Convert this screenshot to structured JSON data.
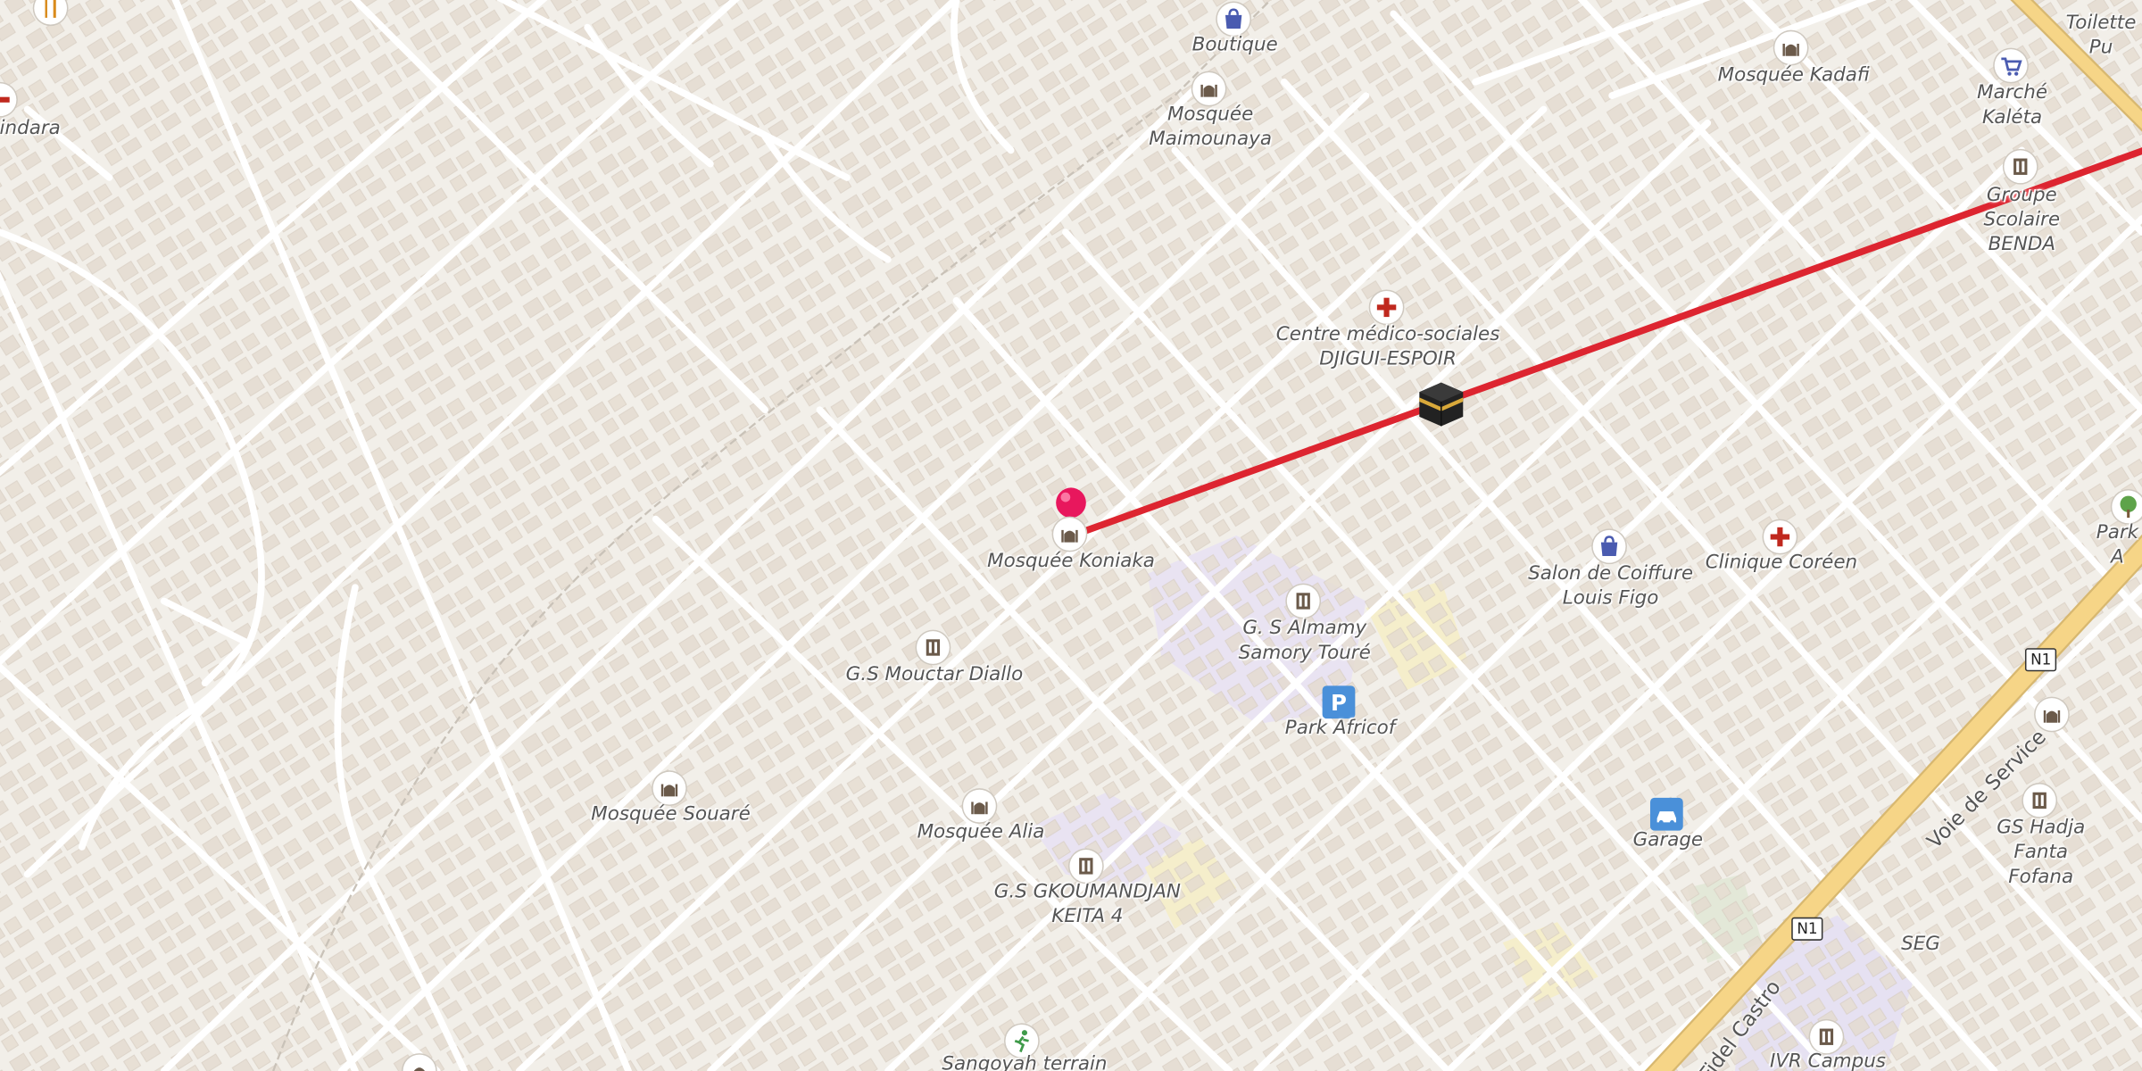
{
  "map": {
    "route_color": "#dd2530",
    "pin_color": "#e8175d",
    "major_road_color": "#f6d587",
    "labels": {
      "boutique": "Boutique",
      "mosquee_maimounaya": "Mosquée\nMaimounaya",
      "mosquee_kadafi": "Mosquée Kadafi",
      "marche_kaleta": "Marché Kaléta",
      "toilette": "Toilette Pu",
      "groupe_scolaire_benda": "Groupe Scolaire\nBENDA",
      "centre_medico": "Centre médico-sociales\nDJIGUI-ESPOIR",
      "indara": "indara",
      "mosquee_koniaka": "Mosquée Koniaka",
      "salon_coiffure": "Salon de Coiffure\nLouis Figo",
      "clinique_coreen": "Clinique Coréen",
      "park_a": "Park A",
      "gs_almamy": "G. S Almamy\nSamory Touré",
      "gs_moucktar": "G.S Mouctar Diallo",
      "park_africof": "Park Africof",
      "mosquee_souare": "Mosquée Souaré",
      "mosquee_alia": "Mosquée Alia",
      "gs_gkoumandjan": "G.S GKOUMANDJAN\nKEITA 4",
      "garage": "Garage",
      "gs_hadja": "GS Hadja\nFanta Fofana",
      "seg": "SEG",
      "ivr_campus": "IVR Campus",
      "sangoyah": "Sangoyah terrain"
    },
    "road_names": {
      "voie_de_service": "Voie de Service",
      "fidel_castro": "Fidel Castro"
    },
    "shields": {
      "n1_upper": "N1",
      "n1_lower": "N1"
    },
    "icons": {
      "mosque": "mosque-icon",
      "school": "school-icon",
      "shop": "shopping-bag-icon",
      "market": "shopping-cart-icon",
      "hospital": "red-cross-icon",
      "parking": "parking-icon",
      "garage": "car-icon",
      "sports": "running-person-icon",
      "restaurant": "fork-knife-icon",
      "park": "tree-icon",
      "kaaba": "kaaba-icon",
      "pin": "map-pin-icon"
    }
  }
}
